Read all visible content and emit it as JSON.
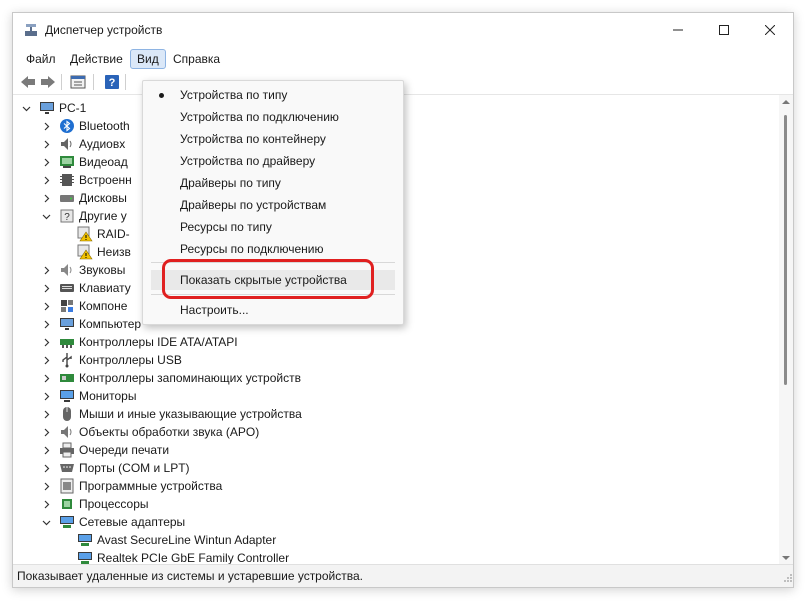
{
  "window": {
    "title": "Диспетчер устройств"
  },
  "menubar": {
    "items": [
      "Файл",
      "Действие",
      "Вид",
      "Справка"
    ],
    "active": "Вид"
  },
  "view_menu": {
    "items": [
      {
        "label": "Устройства по типу",
        "checked": true
      },
      {
        "label": "Устройства по подключению"
      },
      {
        "label": "Устройства по контейнеру"
      },
      {
        "label": "Устройства по драйверу"
      },
      {
        "label": "Драйверы по типу"
      },
      {
        "label": "Драйверы по устройствам"
      },
      {
        "label": "Ресурсы по типу"
      },
      {
        "label": "Ресурсы по подключению"
      },
      {
        "label": "Показать скрытые устройства",
        "highlighted": true
      },
      {
        "label": "Настроить..."
      }
    ],
    "highlight_color": "#e02020"
  },
  "tree": {
    "root": "PC-1",
    "nodes": [
      {
        "label": "Bluetooth",
        "icon": "bluetooth-icon"
      },
      {
        "label": "Аудиовх",
        "icon": "audio-io-icon"
      },
      {
        "label": "Видеоад",
        "icon": "display-adapter-icon"
      },
      {
        "label": "Встроенн",
        "icon": "firmware-icon"
      },
      {
        "label": "Дисковы",
        "icon": "disk-drive-icon"
      },
      {
        "label": "Другие у",
        "icon": "unknown-device-icon",
        "expanded": true
      },
      {
        "label": "RAID-",
        "icon": "warning-device-icon",
        "child": true
      },
      {
        "label": "Неизв",
        "icon": "warning-device-icon",
        "child": true
      },
      {
        "label": "Звуковы",
        "icon": "sound-icon"
      },
      {
        "label": "Клавиату",
        "icon": "keyboard-icon"
      },
      {
        "label": "Компоне",
        "icon": "software-component-icon"
      },
      {
        "label": "Компьютер",
        "icon": "computer-icon"
      },
      {
        "label": "Контроллеры IDE ATA/ATAPI",
        "icon": "ide-controller-icon"
      },
      {
        "label": "Контроллеры USB",
        "icon": "usb-controller-icon"
      },
      {
        "label": "Контроллеры запоминающих устройств",
        "icon": "storage-controller-icon"
      },
      {
        "label": "Мониторы",
        "icon": "monitor-icon"
      },
      {
        "label": "Мыши и иные указывающие устройства",
        "icon": "mouse-icon"
      },
      {
        "label": "Объекты обработки звука (APO)",
        "icon": "apo-icon"
      },
      {
        "label": "Очереди печати",
        "icon": "printer-icon"
      },
      {
        "label": "Порты (COM и LPT)",
        "icon": "port-icon"
      },
      {
        "label": "Программные устройства",
        "icon": "software-device-icon"
      },
      {
        "label": "Процессоры",
        "icon": "processor-icon"
      },
      {
        "label": "Сетевые адаптеры",
        "icon": "network-adapter-icon",
        "expanded": true
      },
      {
        "label": "Avast SecureLine Wintun Adapter",
        "icon": "network-adapter-icon",
        "child": true
      },
      {
        "label": "Realtek PCIe GbE Family Controller",
        "icon": "network-adapter-icon",
        "child": true
      }
    ]
  },
  "statusbar": {
    "text": "Показывает удаленные из системы и устаревшие устройства."
  }
}
